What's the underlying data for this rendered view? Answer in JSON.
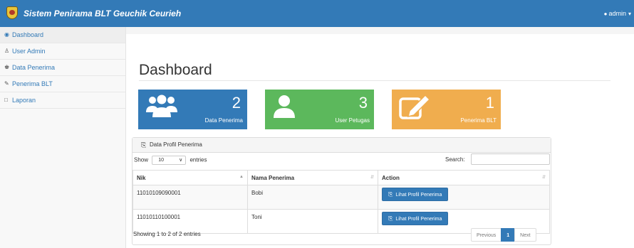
{
  "app": {
    "title": "Sistem Penirama BLT Geuchik Ceurieh"
  },
  "navbar": {
    "user_label": "admin"
  },
  "sidebar": {
    "items": [
      {
        "label": "Dashboard",
        "icon": "dashboard-icon"
      },
      {
        "label": "User Admin",
        "icon": "user-icon"
      },
      {
        "label": "Data Penerima",
        "icon": "users-icon"
      },
      {
        "label": "Penerima BLT",
        "icon": "edit-icon"
      },
      {
        "label": "Laporan",
        "icon": "file-icon"
      }
    ]
  },
  "page": {
    "title": "Dashboard"
  },
  "tiles": [
    {
      "value": "2",
      "label": "Data Penerima",
      "color": "#337ab7",
      "icon": "users-icon"
    },
    {
      "value": "3",
      "label": "User Petugas",
      "color": "#5cb85c",
      "icon": "user-icon"
    },
    {
      "value": "1",
      "label": "Penerima BLT",
      "color": "#f0ad4e",
      "icon": "edit-icon"
    }
  ],
  "panel": {
    "title": "Data Profil Penerima",
    "show_label": "Show",
    "entries_value": "10",
    "entries_label": "entries",
    "search_label": "Search:",
    "columns": [
      "Nik",
      "Nama Penerima",
      "Action"
    ],
    "rows": [
      {
        "nik": "11010109090001",
        "nama": "Bobi",
        "action": "Lihat Profil Penerima"
      },
      {
        "nik": "11010110100001",
        "nama": "Toni",
        "action": "Lihat Profil Penerima"
      }
    ],
    "info": "Showing 1 to 2 of 2 entries",
    "pager": {
      "prev": "Previous",
      "current": "1",
      "next": "Next"
    }
  }
}
